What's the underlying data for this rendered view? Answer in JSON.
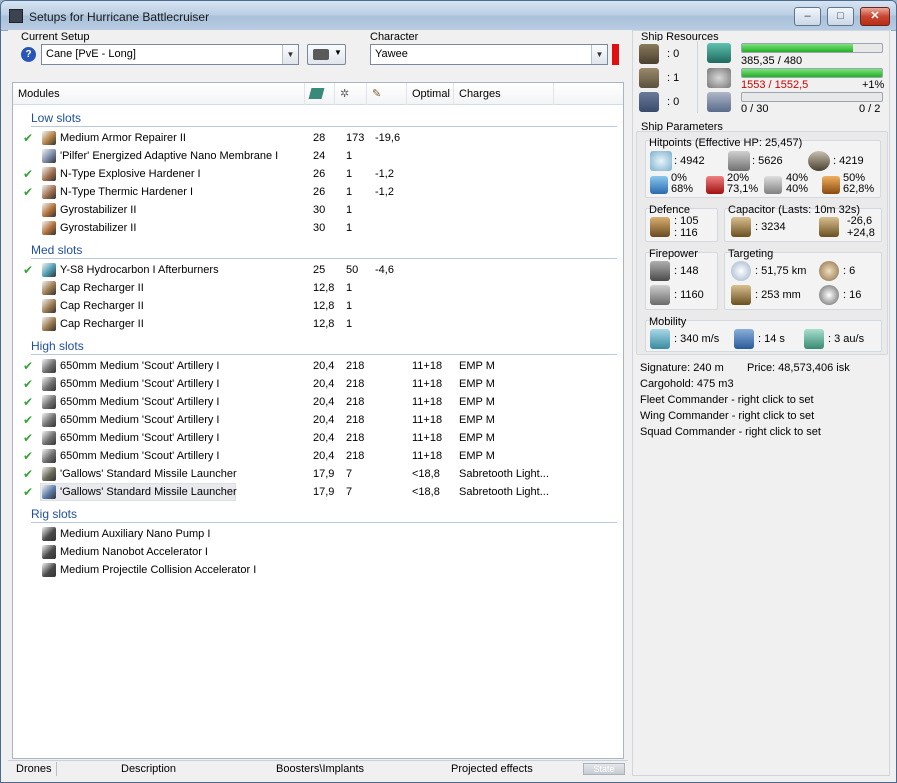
{
  "window": {
    "title": "Setups for Hurricane Battlecruiser",
    "minimize": "–",
    "maximize": "□",
    "close": "✕"
  },
  "current_setup": {
    "label": "Current Setup",
    "value": "Cane [PvE - Long]",
    "help_icon": "?"
  },
  "character": {
    "label": "Character",
    "value": "Yawee"
  },
  "modules": {
    "headers": {
      "modules": "Modules",
      "optimal": "Optimal",
      "charges": "Charges"
    },
    "sections": [
      {
        "title": "Low slots",
        "rows": [
          {
            "checked": true,
            "name": "Medium Armor Repairer II",
            "c1": "28",
            "c2": "173",
            "c3": "-19,6",
            "c4": "",
            "c5": "",
            "icon_color": "#b08040"
          },
          {
            "checked": false,
            "name": "'Pilfer' Energized Adaptive Nano Membrane I",
            "c1": "24",
            "c2": "1",
            "c3": "",
            "c4": "",
            "c5": "",
            "icon_color": "#7a8aa6"
          },
          {
            "checked": true,
            "name": "N-Type Explosive Hardener I",
            "c1": "26",
            "c2": "1",
            "c3": "-1,2",
            "c4": "",
            "c5": "",
            "icon_color": "#a07050"
          },
          {
            "checked": true,
            "name": "N-Type Thermic Hardener I",
            "c1": "26",
            "c2": "1",
            "c3": "-1,2",
            "c4": "",
            "c5": "",
            "icon_color": "#a07050"
          },
          {
            "checked": false,
            "name": "Gyrostabilizer II",
            "c1": "30",
            "c2": "1",
            "c3": "",
            "c4": "",
            "c5": "",
            "icon_color": "#b0703a"
          },
          {
            "checked": false,
            "name": "Gyrostabilizer II",
            "c1": "30",
            "c2": "1",
            "c3": "",
            "c4": "",
            "c5": "",
            "icon_color": "#b0703a"
          }
        ]
      },
      {
        "title": "Med slots",
        "rows": [
          {
            "checked": true,
            "name": "Y-S8 Hydrocarbon I Afterburners",
            "c1": "25",
            "c2": "50",
            "c3": "-4,6",
            "c4": "",
            "c5": "",
            "icon_color": "#4a9ab0"
          },
          {
            "checked": false,
            "name": "Cap Recharger II",
            "c1": "12,8",
            "c2": "1",
            "c3": "",
            "c4": "",
            "c5": "",
            "icon_color": "#9a7a50"
          },
          {
            "checked": false,
            "name": "Cap Recharger II",
            "c1": "12,8",
            "c2": "1",
            "c3": "",
            "c4": "",
            "c5": "",
            "icon_color": "#9a7a50"
          },
          {
            "checked": false,
            "name": "Cap Recharger II",
            "c1": "12,8",
            "c2": "1",
            "c3": "",
            "c4": "",
            "c5": "",
            "icon_color": "#9a7a50"
          }
        ]
      },
      {
        "title": "High slots",
        "rows": [
          {
            "checked": true,
            "name": "650mm Medium 'Scout' Artillery I",
            "c1": "20,4",
            "c2": "218",
            "c3": "",
            "c4": "11+18",
            "c5": "EMP M",
            "icon_color": "#707070"
          },
          {
            "checked": true,
            "name": "650mm Medium 'Scout' Artillery I",
            "c1": "20,4",
            "c2": "218",
            "c3": "",
            "c4": "11+18",
            "c5": "EMP M",
            "icon_color": "#707070"
          },
          {
            "checked": true,
            "name": "650mm Medium 'Scout' Artillery I",
            "c1": "20,4",
            "c2": "218",
            "c3": "",
            "c4": "11+18",
            "c5": "EMP M",
            "icon_color": "#707070"
          },
          {
            "checked": true,
            "name": "650mm Medium 'Scout' Artillery I",
            "c1": "20,4",
            "c2": "218",
            "c3": "",
            "c4": "11+18",
            "c5": "EMP M",
            "icon_color": "#707070"
          },
          {
            "checked": true,
            "name": "650mm Medium 'Scout' Artillery I",
            "c1": "20,4",
            "c2": "218",
            "c3": "",
            "c4": "11+18",
            "c5": "EMP M",
            "icon_color": "#707070"
          },
          {
            "checked": true,
            "name": "650mm Medium 'Scout' Artillery I",
            "c1": "20,4",
            "c2": "218",
            "c3": "",
            "c4": "11+18",
            "c5": "EMP M",
            "icon_color": "#707070"
          },
          {
            "checked": true,
            "name": "'Gallows' Standard Missile Launcher",
            "c1": "17,9",
            "c2": "7",
            "c3": "",
            "c4": "<18,8",
            "c5": "Sabretooth Light...",
            "icon_color": "#6a6a58"
          },
          {
            "checked": true,
            "name": "'Gallows' Standard Missile Launcher",
            "c1": "17,9",
            "c2": "7",
            "c3": "",
            "c4": "<18,8",
            "c5": "Sabretooth Light...",
            "icon_color": "#5a7aa6"
          }
        ]
      },
      {
        "title": "Rig slots",
        "rows": [
          {
            "checked": false,
            "name": "Medium Auxiliary Nano Pump I",
            "c1": "",
            "c2": "",
            "c3": "",
            "c4": "",
            "c5": "",
            "icon_color": "#4a4a4a"
          },
          {
            "checked": false,
            "name": "Medium Nanobot Accelerator I",
            "c1": "",
            "c2": "",
            "c3": "",
            "c4": "",
            "c5": "",
            "icon_color": "#4a4a4a"
          },
          {
            "checked": false,
            "name": "Medium Projectile Collision Accelerator I",
            "c1": "",
            "c2": "",
            "c3": "",
            "c4": "",
            "c5": "",
            "icon_color": "#4a4a4a"
          }
        ]
      }
    ]
  },
  "statusbar": {
    "drones": "Drones",
    "description": "Description",
    "boosters": "Boosters\\Implants",
    "projected": "Projected effects",
    "state": "State"
  },
  "ship_resources": {
    "title": "Ship Resources",
    "turret_count": ": 0",
    "launcher_count": ": 1",
    "calibration_count": ": 0",
    "cpu": "385,35 / 480",
    "cpu_fraction": 0.79,
    "powergrid": "1553 / 1552,5",
    "powergrid_delta": "+1%",
    "powergrid_fraction": 1.0,
    "drone_bay": "0 / 30",
    "drone_bandwidth": "0 / 2",
    "drone_fraction": 0.0
  },
  "ship_parameters": {
    "title": "Ship Parameters",
    "hitpoints_title": "Hitpoints (Effective HP: 25,457)",
    "shield_hp": ": 4942",
    "armor_hp": ": 5626",
    "structure_hp": ": 4219",
    "resist_em": [
      "0%",
      "68%"
    ],
    "resist_thermal": [
      "20%",
      "73,1%"
    ],
    "resist_kinetic": [
      "40%",
      "40%"
    ],
    "resist_explosive": [
      "50%",
      "62,8%"
    ],
    "defence_title": "Defence",
    "defence_a": ": 105",
    "defence_b": ": 116",
    "capacitor_title": "Capacitor (Lasts: 10m 32s)",
    "capacitor_capacity": ": 3234",
    "capacitor_delta_a": "-26,6",
    "capacitor_delta_b": "+24,8",
    "firepower_title": "Firepower",
    "firepower_dps": ": 148",
    "firepower_volley": ": 1160",
    "targeting_title": "Targeting",
    "targeting_range": ": 51,75 km",
    "targeting_max": ": 6",
    "targeting_sig": ": 253 mm",
    "targeting_sensor": ": 16",
    "mobility_title": "Mobility",
    "speed": ": 340 m/s",
    "align": ": 14 s",
    "warp": ": 3 au/s",
    "signature": "Signature: 240 m",
    "price": "Price: 48,573,406 isk",
    "cargohold": "Cargohold: 475 m3",
    "fleet": "Fleet Commander - right click to set",
    "wing": "Wing Commander - right click to set",
    "squad": "Squad Commander - right click to set"
  }
}
